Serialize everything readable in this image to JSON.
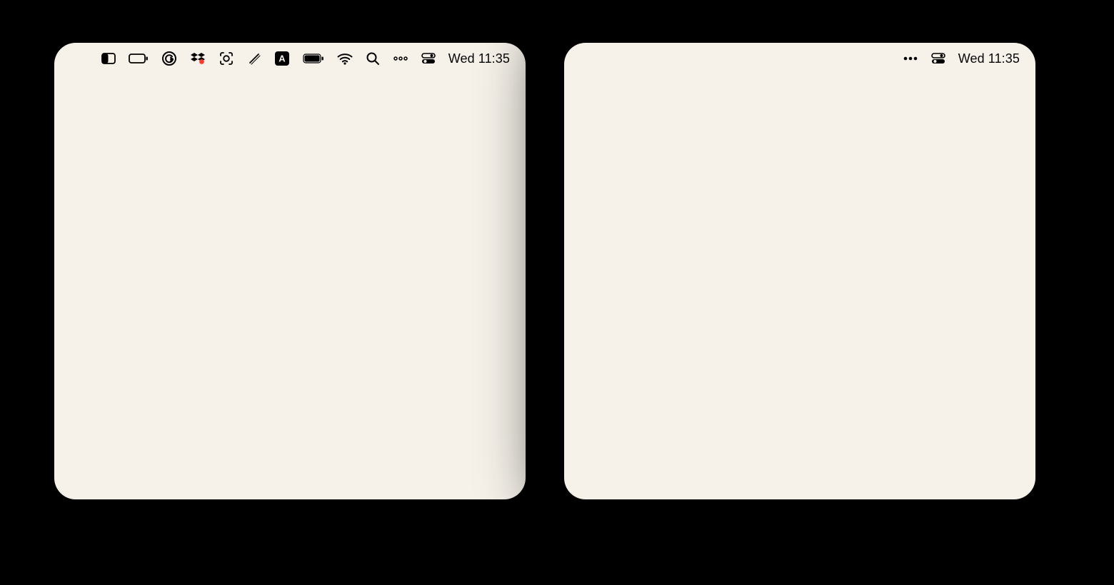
{
  "left": {
    "clock": "Wed 11:35",
    "menubar_icons": [
      "contrast-icon",
      "battery-empty-icon",
      "grammarly-icon",
      "dropbox-icon",
      "screenshot-icon",
      "compose-slash-icon",
      "input-source-icon",
      "battery-full-icon",
      "wifi-icon",
      "spotlight-icon",
      "overflow-icon",
      "control-center-icon"
    ]
  },
  "right": {
    "clock": "Wed 11:35",
    "menubar_icons": [
      "more-dots-icon",
      "control-center-icon"
    ]
  }
}
